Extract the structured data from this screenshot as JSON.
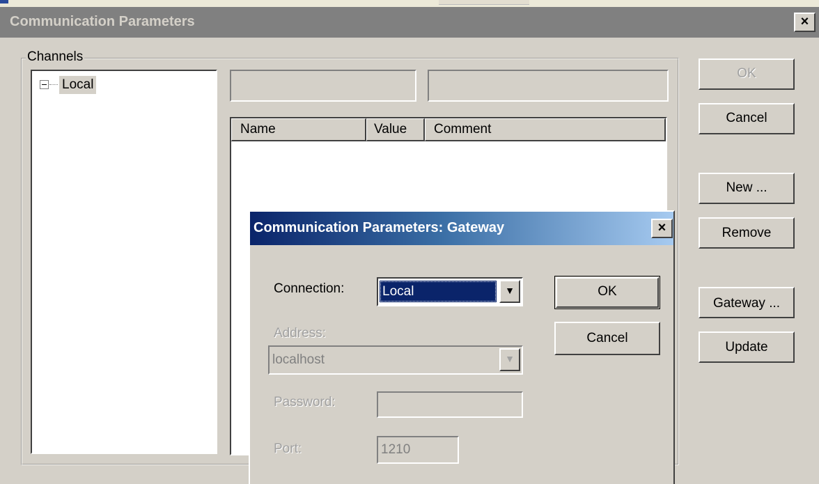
{
  "main_window": {
    "title": "Communication Parameters",
    "close_glyph": "×"
  },
  "channels": {
    "group_label": "Channels",
    "tree": [
      {
        "label": "Local",
        "expander": "−",
        "expanded": true
      }
    ],
    "columns": [
      "Name",
      "Value",
      "Comment"
    ]
  },
  "buttons": {
    "ok": "OK",
    "cancel": "Cancel",
    "new": "New ...",
    "remove": "Remove",
    "gateway": "Gateway ...",
    "update": "Update"
  },
  "gateway_dialog": {
    "title": "Communication Parameters: Gateway",
    "close_glyph": "×",
    "connection_label": "Connection:",
    "connection_value": "Local",
    "address_label": "Address:",
    "address_value": "localhost",
    "password_label": "Password:",
    "password_value": "",
    "port_label": "Port:",
    "port_value": "1210",
    "ok": "OK",
    "cancel": "Cancel",
    "dropdown_glyph": "▼"
  },
  "colors": {
    "face": "#d4d0c8",
    "inactive_title": "#808080",
    "active_title_start": "#0a246a",
    "active_title_end": "#a6caf0",
    "selection": "#0a246a"
  }
}
